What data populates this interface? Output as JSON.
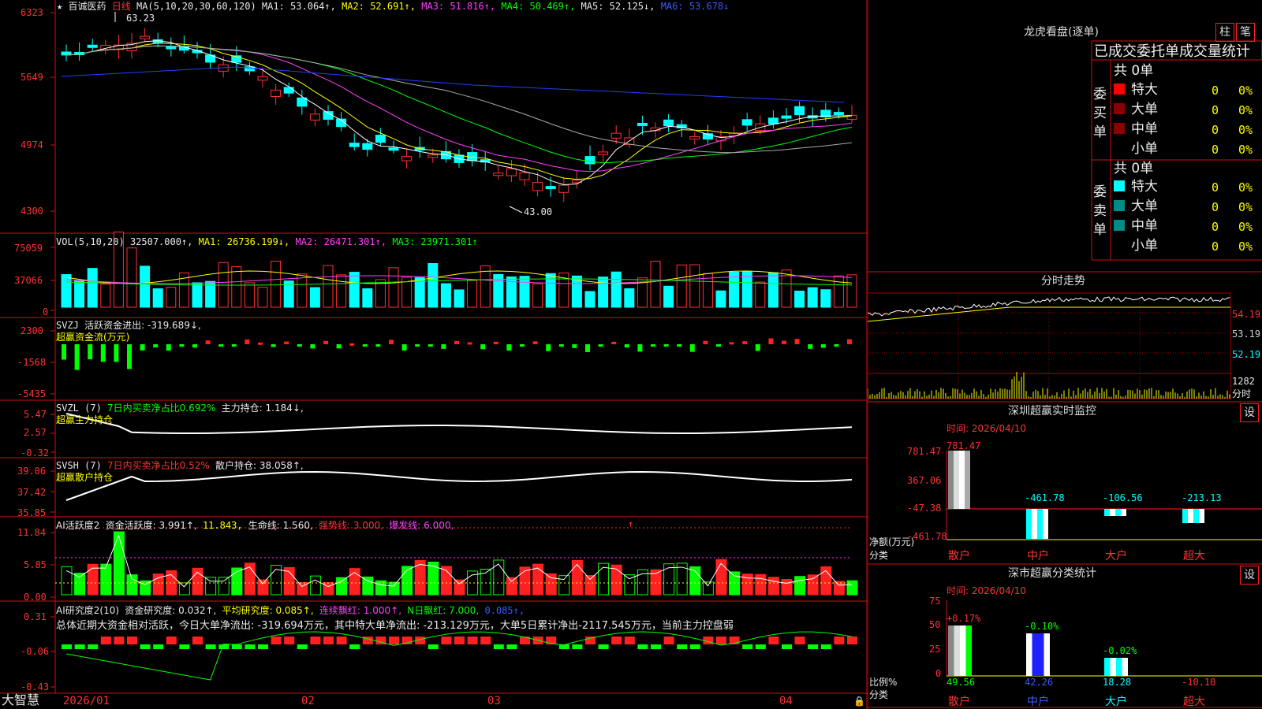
{
  "header": {
    "star": "★",
    "stock_name": "百诚医药",
    "period": "日线",
    "ma_label": "MA(5,10,20,30,60,120)",
    "ma1": "MA1: 53.064↑,",
    "ma2": "MA2: 52.691↑,",
    "ma3": "MA3: 51.816↑,",
    "ma4": "MA4: 50.469↑,",
    "ma5": "MA5: 52.125↓,",
    "ma6": "MA6: 53.678↓"
  },
  "price_axis": [
    "6323",
    "5649",
    "4974",
    "4300"
  ],
  "price_annotations": {
    "high": "63.23",
    "low": "43.00"
  },
  "vol": {
    "label": "VOL(5,10,20)",
    "value": "32507.000↑,",
    "ma1": "MA1: 26736.199↓,",
    "ma2": "MA2: 26471.301↑,",
    "ma3": "MA3: 23971.301↑",
    "axis": [
      "75059",
      "37066",
      "0"
    ]
  },
  "svzj": {
    "label": "SVZJ",
    "text": "活跃资金进出: -319.689↓,",
    "sub": "超赢资金流(万元)",
    "axis": [
      "2300",
      "-1568",
      "-5435"
    ]
  },
  "svzl": {
    "label": "SVZL (7)",
    "text1": "7日内买卖净占比0.692%",
    "text2": "主力持仓: 1.184↓,",
    "sub": "超赢主力持仓",
    "axis": [
      "5.47",
      "2.57",
      "-0.32"
    ]
  },
  "svsh": {
    "label": "SVSH (7)",
    "text1": "7日内买卖净占比0.52%",
    "text2": "散户持仓: 38.058↑,",
    "sub": "超赢散户持仓",
    "axis": [
      "39.06",
      "37.42",
      "35.85"
    ]
  },
  "ai1": {
    "label": "AI活跃度2",
    "t1": "资金活跃度: 3.991↑,",
    "t2": "11.843,",
    "t3": "生命线: 1.560,",
    "t4": "强势线: 3.000,",
    "t5": "爆发线: 6.000,",
    "arrow": "↑",
    "axis": [
      "11.84",
      "5.85",
      "0.00"
    ]
  },
  "ai2": {
    "label": "AI研究度2(10)",
    "t1": "资金研究度: 0.032↑,",
    "t2": "平均研究度: 0.085↑,",
    "t3": "连续飘红: 1.000↑,",
    "t4": "N日飘红: 7.000,",
    "t5": "0.085↑,",
    "summary": "总体近期大资金相对活跃，今日大单净流出: -319.694万元，其中特大单净流出: -213.129万元，大单5日累计净出-2117.545万元，当前主力控盘弱",
    "axis": [
      "0.31",
      "-0.06",
      "-0.43"
    ]
  },
  "footer": {
    "brand": "大智慧",
    "dates": [
      "2026/01",
      "02",
      "03",
      "04"
    ]
  },
  "right": {
    "lhb_title": "龙虎看盘(逐单)",
    "btn_zhu": "柱",
    "btn_bi": "笔",
    "tabs": "已成交委托单成交量统计",
    "buy_label": [
      "委",
      "买",
      "单"
    ],
    "sell_label": [
      "委",
      "卖",
      "单"
    ],
    "buy_total": "共 0单",
    "sell_total": "共 0单",
    "categories": [
      "特大",
      "大单",
      "中单",
      "小单"
    ],
    "zero": "0",
    "pct": "0%",
    "buy_colors": [
      "#ff0000",
      "#8b0000",
      "#8b0000",
      "#000000"
    ],
    "sell_colors": [
      "#00ffff",
      "#008b8b",
      "#008b8b",
      "#000000"
    ],
    "fenshi_title": "分时走势",
    "fenshi_axis": [
      "54.19",
      "53.19",
      "52.19",
      "1282",
      "分时"
    ],
    "sz_title": "深圳超赢实时监控",
    "set_btn": "设",
    "sz_time": "时间: 2026/04/10",
    "sz_axis": [
      "781.47",
      "367.06",
      "-47.38",
      "-461.78"
    ],
    "sz_values": [
      "781.47",
      "-461.78",
      "-106.56",
      "-213.13"
    ],
    "sz_ylabel1": "净额(万元)",
    "sz_ylabel2": "分类",
    "groups": [
      "散户",
      "中户",
      "大户",
      "超大"
    ],
    "ss_title": "深市超赢分类统计",
    "ss_time": "时间: 2026/04/10",
    "ss_axis": [
      "75",
      "50",
      "25",
      "0"
    ],
    "ss_pcts": [
      "+0.17%",
      "-0.10%",
      "-0.02%"
    ],
    "ss_values": [
      "49.56",
      "42.26",
      "18.28",
      "-10.10"
    ],
    "ss_ylabel1": "比例%",
    "ss_ylabel2": "分类"
  }
}
